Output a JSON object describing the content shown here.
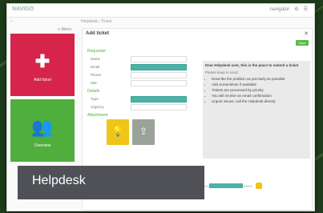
{
  "overlay": {
    "label": "Helpdesk"
  },
  "app": {
    "logo": "NAVIGO",
    "user": "navigator",
    "crumb": "Helpdesk › Ticket"
  },
  "sidebar": {
    "header": "≡ Menu",
    "tiles": [
      {
        "label": "Add ticket",
        "icon": "plus-icon",
        "color": "#d6244a"
      },
      {
        "label": "Overview",
        "icon": "users-icon",
        "color": "#4fae3c"
      }
    ]
  },
  "panel": {
    "title": "Add ticket",
    "save": "Save",
    "section1": "Requester",
    "section2": "Details",
    "section3": "Attachment",
    "rows": [
      {
        "label": "Name",
        "value": "",
        "active": false
      },
      {
        "label": "Email",
        "value": "",
        "active": true
      },
      {
        "label": "Phone",
        "value": "",
        "active": false
      },
      {
        "label": "Site",
        "value": "",
        "active": false
      }
    ],
    "rows2": [
      {
        "label": "Type",
        "value": "",
        "active": true
      },
      {
        "label": "Urgency",
        "value": "",
        "active": false
      }
    ]
  },
  "info": {
    "title": "Dear Helpdesk user, this is the place to submit a ticket",
    "subtitle": "Please keep in mind:",
    "bullets": [
      "Describe the problem as precisely as possible",
      "Add screenshots if available",
      "Tickets are processed by priority",
      "You will receive an email confirmation",
      "Urgent issues: call the Helpdesk directly"
    ]
  }
}
